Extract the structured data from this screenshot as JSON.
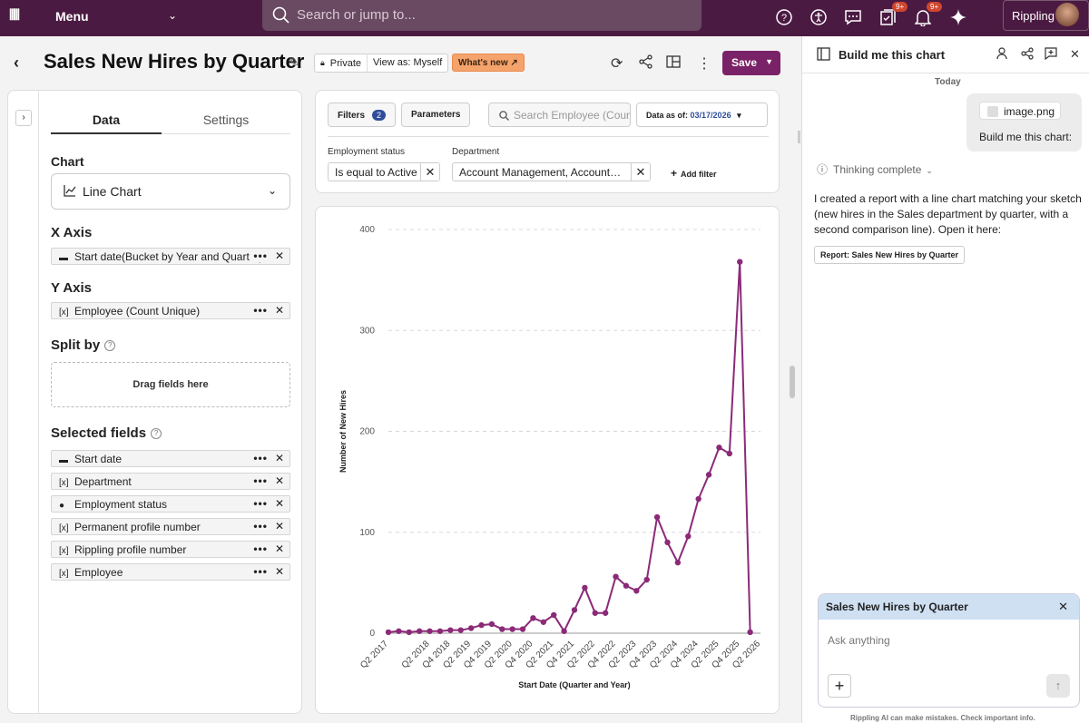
{
  "topbar": {
    "logo": "⦀⦀",
    "menu_label": "Menu",
    "search_placeholder": "Search or jump to...",
    "badges": [
      "9+",
      "9+"
    ],
    "account_label": "Rippling",
    "icons": [
      "help-icon",
      "accessibility-icon",
      "chat-icon",
      "tasks-icon",
      "bell-icon",
      "ai-sparkle-icon"
    ]
  },
  "header": {
    "title": "Sales New Hires by Quarter",
    "visibility": "Private",
    "view_as": "View as: Myself",
    "whats_new": "What's new",
    "save_label": "Save"
  },
  "config_panel": {
    "tabs": [
      "Data",
      "Settings"
    ],
    "active_tab": "Data",
    "chart_label": "Chart",
    "chart_type": "Line Chart",
    "x_axis_label": "X Axis",
    "x_axis_field": "Start date(Bucket by Year and Quarter)",
    "y_axis_label": "Y Axis",
    "y_axis_field": "Employee (Count Unique)",
    "split_by_label": "Split by",
    "drop_hint": "Drag fields here",
    "selected_fields_label": "Selected fields",
    "selected_fields": [
      {
        "icon": "calendar-icon",
        "label": "Start date"
      },
      {
        "icon": "text-field-icon",
        "label": "Department"
      },
      {
        "icon": "status-icon",
        "label": "Employment status"
      },
      {
        "icon": "text-field-icon",
        "label": "Permanent profile number"
      },
      {
        "icon": "text-field-icon",
        "label": "Rippling profile number"
      },
      {
        "icon": "text-field-icon",
        "label": "Employee"
      }
    ]
  },
  "filters": {
    "filters_label": "Filters",
    "filters_count": "2",
    "parameters_label": "Parameters",
    "search_placeholder": "Search Employee (Count Unique)",
    "data_as_of_label": "Data as of:",
    "data_as_of_date": "03/17/2026",
    "employment_status_label": "Employment status",
    "employment_status_value": "Is equal to Active",
    "department_label": "Department",
    "department_value": "Account Management, Accountants, Sales",
    "add_filter_label": "Add filter"
  },
  "chart_data": {
    "type": "line",
    "xlabel": "Start Date (Quarter and Year)",
    "ylabel": "Number of New Hires",
    "ylim": [
      0,
      400
    ],
    "yticks": [
      0,
      100,
      200,
      300,
      400
    ],
    "color": "#8b2a78",
    "x": [
      "Q2 2017",
      "Q3 2017",
      "Q4 2017",
      "Q1 2018",
      "Q2 2018",
      "Q3 2018",
      "Q4 2018",
      "Q1 2019",
      "Q2 2019",
      "Q3 2019",
      "Q4 2019",
      "Q1 2020",
      "Q2 2020",
      "Q3 2020",
      "Q4 2020",
      "Q1 2021",
      "Q2 2021",
      "Q3 2021",
      "Q4 2021",
      "Q1 2022",
      "Q2 2022",
      "Q3 2022",
      "Q4 2022",
      "Q1 2023",
      "Q2 2023",
      "Q3 2023",
      "Q4 2023",
      "Q1 2024",
      "Q2 2024",
      "Q3 2024",
      "Q4 2024",
      "Q1 2025",
      "Q2 2025",
      "Q3 2025",
      "Q4 2025",
      "Q1 2026",
      "Q2 2026"
    ],
    "xtick_labels": [
      "Q2 2017",
      "Q2 2018",
      "Q4 2018",
      "Q2 2019",
      "Q4 2019",
      "Q2 2020",
      "Q4 2020",
      "Q2 2021",
      "Q4 2021",
      "Q2 2022",
      "Q4 2022",
      "Q2 2023",
      "Q4 2023",
      "Q2 2024",
      "Q4 2024",
      "Q2 2025",
      "Q4 2025",
      "Q2 2026"
    ],
    "values": [
      1,
      2,
      1,
      2,
      2,
      2,
      3,
      3,
      5,
      8,
      9,
      4,
      4,
      4,
      15,
      11,
      18,
      2,
      23,
      45,
      20,
      20,
      56,
      47,
      42,
      53,
      115,
      90,
      70,
      96,
      133,
      157,
      184,
      178,
      368,
      1
    ]
  },
  "chat": {
    "header_title": "Build me this chart",
    "date_label": "Today",
    "attachment_name": "image.png",
    "user_message": "Build me this chart:",
    "thinking_label": "Thinking complete",
    "assistant_reply": "I created a report with a line chart matching your sketch (new hires in the Sales department by quarter, with a second comparison line). Open it here:",
    "report_link_label": "Report: Sales New Hires by Quarter",
    "composer_context": "Sales New Hires by Quarter",
    "composer_placeholder": "Ask anything",
    "disclaimer": "Rippling AI can make mistakes. Check important info."
  }
}
